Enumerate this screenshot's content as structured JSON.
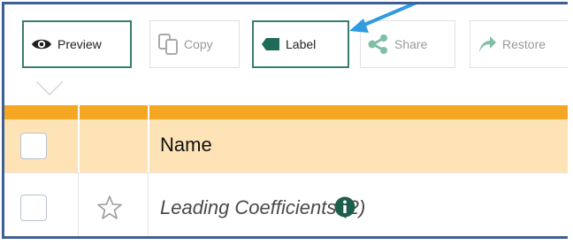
{
  "toolbar": {
    "preview_label": "Preview",
    "copy_label": "Copy",
    "label_label": "Label",
    "share_label": "Share",
    "restore_label": "Restore"
  },
  "table": {
    "header": {
      "name_label": "Name"
    },
    "rows": [
      {
        "name": "Leading Coefficients (2)",
        "starred": false
      }
    ]
  },
  "colors": {
    "accent_teal": "#3a7d6f",
    "header_orange": "#f5a623",
    "header_fill": "#fde3b6",
    "frame_blue": "#3f5f94",
    "callout_arrow": "#2f9be0"
  },
  "icons": [
    "eye-icon",
    "copy-icon",
    "tag-icon",
    "share-icon",
    "restore-icon",
    "star-icon",
    "info-icon"
  ]
}
